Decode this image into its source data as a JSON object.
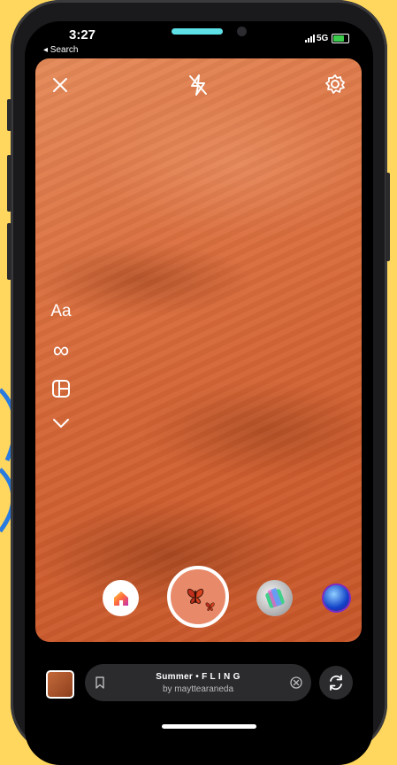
{
  "status_bar": {
    "time": "3:27",
    "back_label": "◂ Search",
    "network": "5G",
    "battery_level": 0.8
  },
  "camera": {
    "close_icon": "close-icon",
    "flash_icon": "flash-off-icon",
    "settings_icon": "settings-gear-icon",
    "tools": [
      {
        "name": "create-mode",
        "label": "Aa"
      },
      {
        "name": "boomerang",
        "label": "∞"
      },
      {
        "name": "layout",
        "icon": "layout-icon"
      },
      {
        "name": "more",
        "icon": "chevron-down-icon"
      }
    ],
    "effects": [
      "home-effect",
      "butterfly-effect",
      "prism-effect",
      "blue-orb-effect"
    ]
  },
  "bottom": {
    "effect_name": "Summer • F L I N G",
    "effect_author": "by mayttearaneda"
  },
  "colors": {
    "background": "#ffd75e",
    "accent": "#5de0e6",
    "deco_blue": "#2a7be0"
  }
}
